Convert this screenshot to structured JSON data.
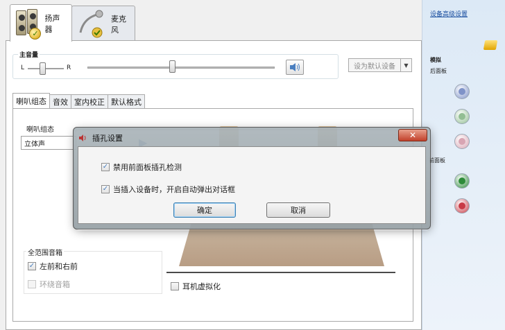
{
  "tabs": [
    {
      "label": "扬声器",
      "icon": "speaker-icon",
      "active": true
    },
    {
      "label": "麦克风",
      "icon": "microphone-icon",
      "active": false
    }
  ],
  "volume": {
    "group_title": "主音量",
    "left_label": "L",
    "right_label": "R",
    "balance_level": 0.4,
    "level": 0.45,
    "mute_icon": "speaker-volume-icon"
  },
  "default_device": {
    "label": "设为默认设备",
    "arrow": "▼"
  },
  "subtabs": [
    "喇叭组态",
    "音效",
    "室内校正",
    "默认格式"
  ],
  "speaker_config": {
    "label": "喇叭组态",
    "value": "立体声"
  },
  "full_range": {
    "title": "全范围音箱",
    "items": [
      {
        "label": "左前和右前",
        "checked": true,
        "disabled": false
      },
      {
        "label": "环绕音箱",
        "checked": false,
        "disabled": true
      }
    ]
  },
  "headphone_virtualization": {
    "label": "耳机虚拟化",
    "checked": false
  },
  "sidebar": {
    "advanced_link": "设备高级设置",
    "analog_label": "模拟",
    "rear_panel_label": "后面板",
    "front_panel_label": "前面板",
    "rear_jacks": [
      {
        "color": "#7f93c8"
      },
      {
        "color": "#92be93"
      },
      {
        "color": "#d8a5b3"
      }
    ],
    "front_jacks": [
      {
        "color": "#2e8b3a"
      },
      {
        "color": "#c83a45"
      }
    ]
  },
  "dialog": {
    "title": "插孔设置",
    "close_label": "✕",
    "options": [
      {
        "label": "禁用前面板插孔检测",
        "checked": true
      },
      {
        "label": "当插入设备时，开启自动弹出对话框",
        "checked": true
      }
    ],
    "ok_label": "确定",
    "cancel_label": "取消"
  }
}
